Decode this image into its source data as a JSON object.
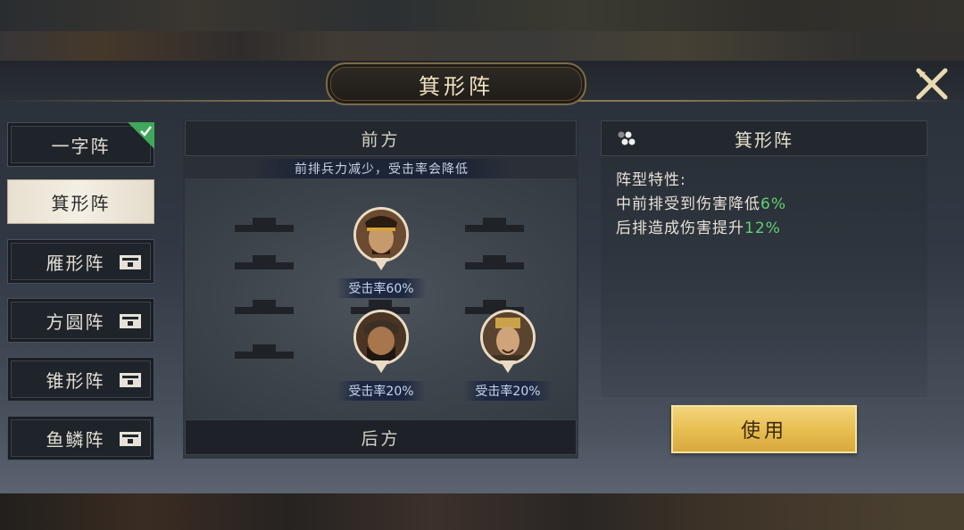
{
  "header": {
    "title": "箕形阵"
  },
  "tabs": [
    {
      "label": "一字阵",
      "state": "equipped"
    },
    {
      "label": "箕形阵",
      "state": "selected"
    },
    {
      "label": "雁形阵",
      "state": "locked"
    },
    {
      "label": "方圆阵",
      "state": "locked"
    },
    {
      "label": "锥形阵",
      "state": "locked"
    },
    {
      "label": "鱼鳞阵",
      "state": "locked"
    }
  ],
  "formation": {
    "front_label": "前方",
    "back_label": "后方",
    "hint": "前排兵力减少，受击率会降低",
    "heroes": [
      {
        "rate": "受击率60%"
      },
      {
        "rate": "受击率20%"
      },
      {
        "rate": "受击率20%"
      }
    ]
  },
  "info": {
    "title": "箕形阵",
    "heading": "阵型特性:",
    "line1_text": "中前排受到伤害降低",
    "line1_value": "6%",
    "line2_text": "后排造成伤害提升",
    "line2_value": "12%"
  },
  "actions": {
    "use_label": "使用"
  },
  "colors": {
    "accent_gold": "#e8bf52",
    "bonus_green": "#5fd36f",
    "check_green": "#3fa85a"
  }
}
